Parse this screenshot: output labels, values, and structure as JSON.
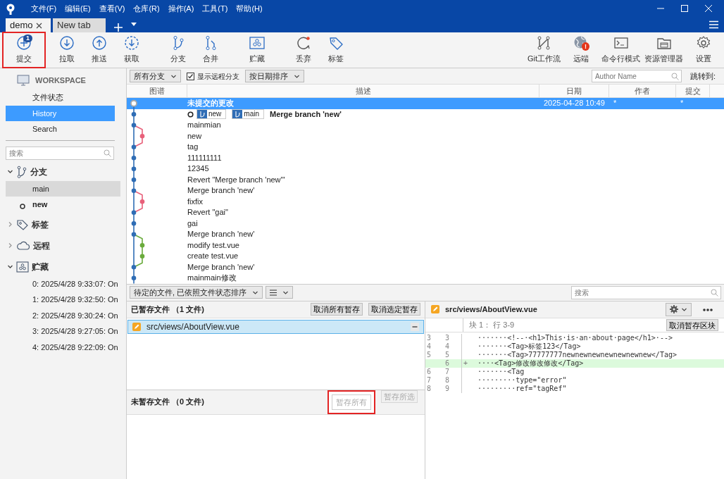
{
  "menu": [
    "文件(F)",
    "编辑(E)",
    "查看(V)",
    "仓库(R)",
    "操作(A)",
    "工具(T)",
    "帮助(H)"
  ],
  "tabs": [
    {
      "label": "demo",
      "selected": true,
      "closable": true
    },
    {
      "label": "New tab",
      "selected": false,
      "closable": false
    }
  ],
  "toolbar": {
    "left_groups": [
      [
        {
          "label": "提交",
          "kind": "commit",
          "badge": {
            "text": "1",
            "kind": "count"
          },
          "highlighted": true
        }
      ],
      [
        {
          "label": "拉取",
          "kind": "pull",
          "highlighted": false
        },
        {
          "label": "推送",
          "kind": "push",
          "highlighted": false
        },
        {
          "label": "获取",
          "kind": "fetch",
          "highlighted": false
        }
      ],
      [
        {
          "label": "分支",
          "kind": "branch",
          "highlighted": false
        },
        {
          "label": "合并",
          "kind": "merge",
          "highlighted": false
        }
      ],
      [
        {
          "label": "贮藏",
          "kind": "stash",
          "highlighted": false
        }
      ],
      [
        {
          "label": "丢弃",
          "kind": "discard",
          "highlighted": false
        },
        {
          "label": "标签",
          "kind": "tag",
          "highlighted": false
        }
      ]
    ],
    "right": [
      {
        "label": "Git工作流",
        "kind": "flow",
        "highlighted": false
      },
      {
        "label": "远端",
        "kind": "remote",
        "badge": {
          "text": "!",
          "kind": "alert"
        },
        "highlighted": false
      },
      {
        "label": "命令行模式",
        "kind": "terminal",
        "highlighted": false
      },
      {
        "label": "资源管理器",
        "kind": "explorer",
        "highlighted": false
      },
      {
        "label": "设置",
        "kind": "settings",
        "highlighted": false
      }
    ]
  },
  "sidebar": {
    "workspace": {
      "title": "WORKSPACE",
      "items": [
        {
          "label": "文件状态",
          "selected": false
        },
        {
          "label": "History",
          "selected": true
        },
        {
          "label": "Search",
          "selected": false
        }
      ]
    },
    "search": {
      "placeholder": "搜索"
    },
    "groups": [
      {
        "label": "分支",
        "kind": "branch",
        "expanded": true,
        "items": [
          {
            "label": "main",
            "selected": true,
            "current": false
          },
          {
            "label": "new",
            "selected": false,
            "current": true
          }
        ]
      },
      {
        "label": "标签",
        "kind": "tag",
        "expanded": false
      },
      {
        "label": "远程",
        "kind": "cloud",
        "expanded": false
      },
      {
        "label": "贮藏",
        "kind": "stash",
        "expanded": true,
        "items": [
          {
            "label": "0: 2025/4/28 9:33:07: On",
            "selected": false,
            "current": false
          },
          {
            "label": "1: 2025/4/28 9:32:50: On",
            "selected": false,
            "current": false
          },
          {
            "label": "2: 2025/4/28 9:30:24: On",
            "selected": false,
            "current": false
          },
          {
            "label": "3: 2025/4/28 9:27:05: On",
            "selected": false,
            "current": false
          },
          {
            "label": "4: 2025/4/28 9:22:09: On",
            "selected": false,
            "current": false
          }
        ]
      }
    ]
  },
  "history_filter": {
    "branches": "所有分支",
    "show_remote": {
      "label": "显示远程分支",
      "checked": true
    },
    "sort": "按日期排序",
    "author": {
      "placeholder": "Author Name"
    },
    "jump_label": "跳转到:"
  },
  "history": {
    "columns": [
      "图谱",
      "描述",
      "日期",
      "作者",
      "提交"
    ],
    "rows": [
      {
        "kind": "uncommitted",
        "description": "未提交的更改",
        "date": "2025-04-28 10:49",
        "author": "*",
        "commit": "*",
        "selected": true,
        "bold": true
      },
      {
        "kind": "mainline",
        "color": "#2f6db5",
        "description": "Merge branch 'new'",
        "bold": true,
        "head": true,
        "refs": [
          "new",
          "main"
        ],
        "selected": false
      },
      {
        "kind": "mainline",
        "color": "#2f6db5",
        "description": "mainmian",
        "bold": false,
        "head": false,
        "selected": false
      },
      {
        "kind": "sideline",
        "color": "#e8607a",
        "description": "new",
        "bold": false,
        "head": false,
        "selected": false
      },
      {
        "kind": "mainline",
        "color": "#2f6db5",
        "description": "tag",
        "bold": false,
        "head": false,
        "selected": false
      },
      {
        "kind": "mainline",
        "color": "#2f6db5",
        "description": "111111111",
        "bold": false,
        "head": false,
        "selected": false
      },
      {
        "kind": "mainline",
        "color": "#2f6db5",
        "description": "12345",
        "bold": false,
        "head": false,
        "selected": false
      },
      {
        "kind": "mainline",
        "color": "#2f6db5",
        "description": "Revert \"Merge branch 'new'\"",
        "bold": false,
        "head": false,
        "selected": false
      },
      {
        "kind": "mainline",
        "color": "#2f6db5",
        "description": "Merge branch 'new'",
        "bold": false,
        "head": false,
        "selected": false
      },
      {
        "kind": "sideline",
        "color": "#e8607a",
        "description": "fixfix",
        "bold": false,
        "head": false,
        "selected": false
      },
      {
        "kind": "mainline",
        "color": "#2f6db5",
        "description": "Revert \"gai\"",
        "bold": false,
        "head": false,
        "selected": false
      },
      {
        "kind": "mainline",
        "color": "#2f6db5",
        "description": "gai",
        "bold": false,
        "head": false,
        "selected": false
      },
      {
        "kind": "mainline",
        "color": "#2f6db5",
        "description": "Merge branch 'new'",
        "bold": false,
        "head": false,
        "selected": false
      },
      {
        "kind": "sideline",
        "color": "#6aab3c",
        "description": "modify test.vue",
        "bold": false,
        "head": false,
        "selected": false
      },
      {
        "kind": "sideline",
        "color": "#6aab3c",
        "description": "create test.vue",
        "bold": false,
        "head": false,
        "selected": false
      },
      {
        "kind": "mainline",
        "color": "#2f6db5",
        "description": "Merge branch 'new'",
        "bold": false,
        "head": false,
        "selected": false
      },
      {
        "kind": "mainline",
        "color": "#2f6db5",
        "description": "mainmain修改",
        "bold": false,
        "head": false,
        "selected": false
      }
    ]
  },
  "files_bar": {
    "sort": "待定的文件, 已依照文件状态排序",
    "search": {
      "placeholder": "搜索"
    }
  },
  "staged": {
    "title": "已暂存文件 （1 文件)",
    "buttons": [
      {
        "label": "取消所有暂存",
        "disabled": false,
        "highlighted": false
      },
      {
        "label": "取消选定暂存",
        "disabled": false,
        "highlighted": false
      }
    ],
    "files": [
      {
        "path": "src/views/AboutView.vue",
        "selected": true
      }
    ]
  },
  "unstaged": {
    "title": "未暂存文件 （0 文件)",
    "buttons": [
      {
        "label": "暂存所有",
        "disabled": true,
        "highlighted": true
      },
      {
        "label": "暂存所选",
        "disabled": true,
        "highlighted": false
      }
    ]
  },
  "diff": {
    "file": "src/views/AboutView.vue",
    "hunk": "块 1： 行 3-9",
    "hunk_button": "取消暂存区块",
    "lines": [
      {
        "kind": "context",
        "old": "3",
        "new": "3",
        "text": "·······<!--·<h1>This·is·an·about·page</h1>·-->"
      },
      {
        "kind": "context",
        "old": "4",
        "new": "4",
        "text": "·······<Tag>标签123</Tag>"
      },
      {
        "kind": "context",
        "old": "5",
        "new": "5",
        "text": "·······<Tag>77777777newnewnewnewnewnewnew</Tag>"
      },
      {
        "kind": "added",
        "new": "6",
        "marker": "+",
        "text": "····<Tag>修改修改修改</Tag>"
      },
      {
        "kind": "context",
        "old": "6",
        "new": "7",
        "text": "·······<Tag"
      },
      {
        "kind": "context",
        "old": "7",
        "new": "8",
        "text": "·········type=\"error\""
      },
      {
        "kind": "context",
        "old": "8",
        "new": "9",
        "text": "·········ref=\"tagRef\""
      }
    ]
  }
}
